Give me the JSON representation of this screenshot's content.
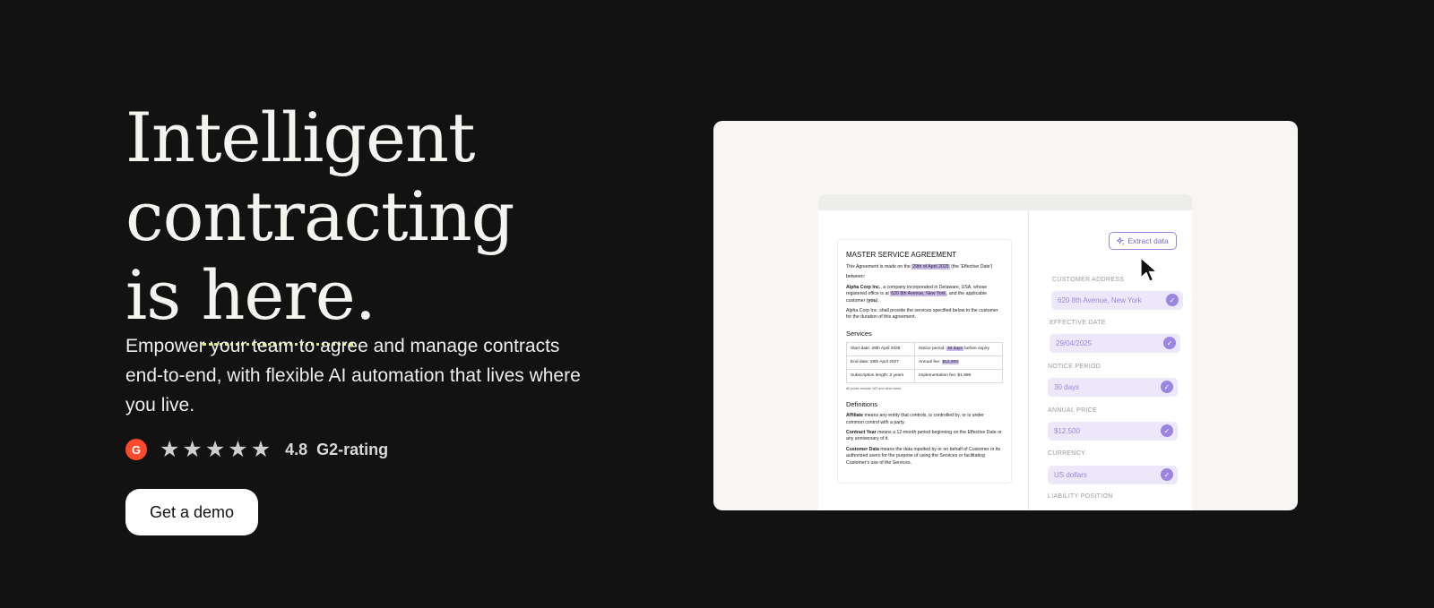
{
  "hero": {
    "title_line1": "Intelligent",
    "title_line2": "contracting",
    "title_line3_prefix": "is ",
    "title_line3_highlight": "here",
    "title_line3_suffix": ".",
    "subtitle": "Empower your team to agree and manage contracts end-to-end, with flexible AI automation that lives where you live."
  },
  "rating": {
    "badge": "G",
    "stars": [
      "★",
      "★",
      "★",
      "★",
      "★"
    ],
    "value": "4.8",
    "label": "G2-rating"
  },
  "cta": {
    "label": "Get a demo"
  },
  "document": {
    "title": "MASTER SERVICE AGREEMENT",
    "intro_pre": "This Agreement is made on the ",
    "intro_date": "29th of April 2025",
    "intro_post": " (the 'Effective Date')",
    "between": "between:",
    "party_name": "Alpha Corp Inc.",
    "party_pre": ", a company incorporated in Delaware, USA, whose registered office is at ",
    "party_address": "620 8th Avenue, New York",
    "party_post": ", and the applicable customer (",
    "party_you": "you",
    "party_end": ").",
    "services_intro": "Alpha Corp Inc. shall provide the services specified below to the customer for the duration of this agreement.",
    "services_heading": "Services",
    "table": {
      "start_date": "Start date: 29th April 2025",
      "notice_pre": "Notice period: ",
      "notice_value": "30 days",
      "notice_post": " before expiry",
      "end_date": "End date: 28th April 2027",
      "annual_pre": "Annual fee: ",
      "annual_value": "$12,500",
      "subscription": "Subscription length: 2 years",
      "implementation": "Implementation fee: $1,999"
    },
    "vat_note": "All prices exclude VAT and other taxes.",
    "definitions_heading": "Definitions",
    "def_affiliate_term": "Affiliate",
    "def_affiliate_text": " means any entity that controls, is controlled by, or is under common control with a party.",
    "def_contract_term": "Contract Year",
    "def_contract_text": " means a 12-month period beginning on the Effective Date or any anniversary of it.",
    "def_customer_term": "Customer Data",
    "def_customer_text": " means the data inputted by or on behalf of Customer or its authorized users for the purpose of using the Services or facilitating Customer's use of the Services."
  },
  "extraction": {
    "button_label": "Extract data",
    "button_icon": "sparkle-icon",
    "fields": [
      {
        "label": "CUSTOMER ADDRESS",
        "value": "620 8th Avenue, New York"
      },
      {
        "label": "EFFECTIVE DATE",
        "value": "29/04/2025"
      },
      {
        "label": "NOTICE PERIOD",
        "value": "30 days"
      },
      {
        "label": "ANNUAL PRICE",
        "value": "$12,500"
      },
      {
        "label": "CURRENCY",
        "value": "US dollars"
      },
      {
        "label": "LIABILITY POSITION",
        "value": ""
      }
    ],
    "check_glyph": "✓"
  },
  "colors": {
    "background": "#121212",
    "accent_underline": "#d6ef5c",
    "brand_purple": "#9b85e0",
    "g2_red": "#ff492c"
  }
}
